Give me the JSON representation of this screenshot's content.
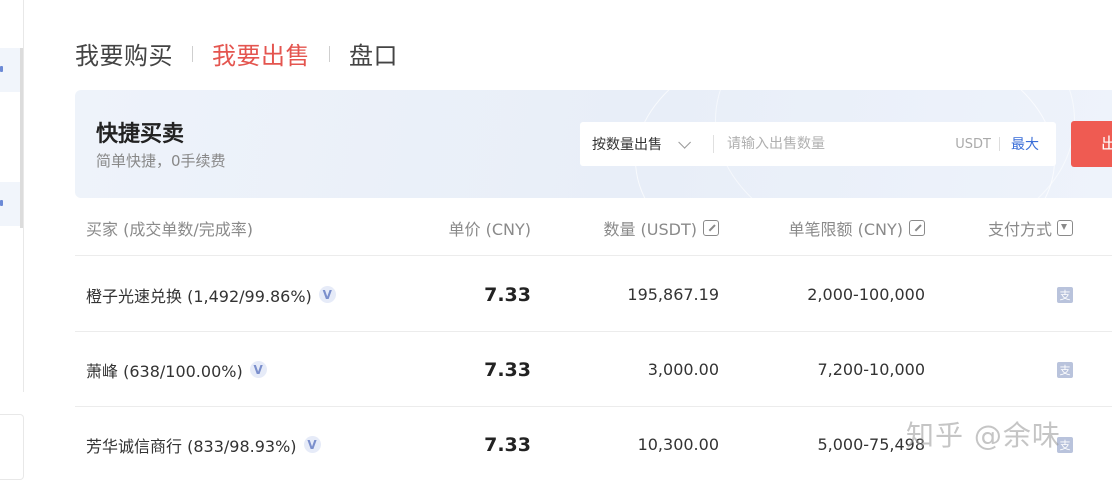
{
  "tabs": [
    {
      "label": "我要购买",
      "active": false
    },
    {
      "label": "我要出售",
      "active": true
    },
    {
      "label": "盘口",
      "active": false
    }
  ],
  "quick_trade": {
    "title": "快捷买卖",
    "subtitle": "简单快捷，0手续费",
    "mode_label": "按数量出售",
    "quantity_placeholder": "请输入出售数量",
    "unit": "USDT",
    "max_label": "最大",
    "sell_label": "出售"
  },
  "table": {
    "headers": {
      "buyer": "买家 (成交单数/完成率)",
      "price": "单价 (CNY)",
      "quantity": "数量 (USDT)",
      "limit": "单笔限额 (CNY)",
      "payment": "支付方式"
    },
    "rows": [
      {
        "merchant": "橙子光速兑换 (1,492/99.86%)",
        "badge": "V",
        "price": "7.33",
        "quantity": "195,867.19",
        "limit": "2,000-100,000",
        "payment_icon": "alipay-icon"
      },
      {
        "merchant": "萧峰 (638/100.00%)",
        "badge": "V",
        "price": "7.33",
        "quantity": "3,000.00",
        "limit": "7,200-10,000",
        "payment_icon": "alipay-icon"
      },
      {
        "merchant": "芳华诚信商行 (833/98.93%)",
        "badge": "V",
        "price": "7.33",
        "quantity": "10,300.00",
        "limit": "5,000-75,498",
        "payment_icon": "alipay-icon"
      }
    ]
  },
  "watermark": "知乎 @余味",
  "colors": {
    "accent_red": "#e4554f",
    "sell_button": "#ef5b52",
    "link_blue": "#3a6ed8"
  }
}
